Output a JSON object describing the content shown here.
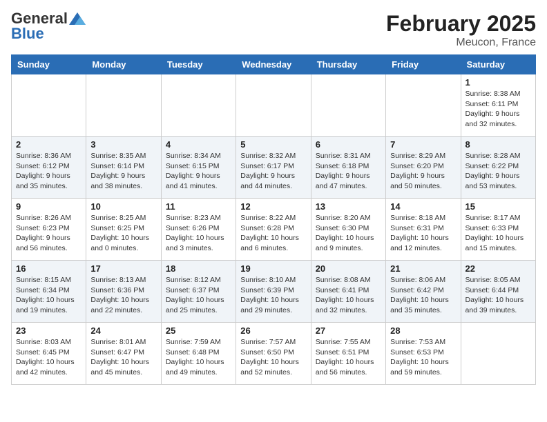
{
  "header": {
    "logo_general": "General",
    "logo_blue": "Blue",
    "month": "February 2025",
    "location": "Meucon, France"
  },
  "weekdays": [
    "Sunday",
    "Monday",
    "Tuesday",
    "Wednesday",
    "Thursday",
    "Friday",
    "Saturday"
  ],
  "weeks": [
    [
      {
        "day": "",
        "info": ""
      },
      {
        "day": "",
        "info": ""
      },
      {
        "day": "",
        "info": ""
      },
      {
        "day": "",
        "info": ""
      },
      {
        "day": "",
        "info": ""
      },
      {
        "day": "",
        "info": ""
      },
      {
        "day": "1",
        "info": "Sunrise: 8:38 AM\nSunset: 6:11 PM\nDaylight: 9 hours and 32 minutes."
      }
    ],
    [
      {
        "day": "2",
        "info": "Sunrise: 8:36 AM\nSunset: 6:12 PM\nDaylight: 9 hours and 35 minutes."
      },
      {
        "day": "3",
        "info": "Sunrise: 8:35 AM\nSunset: 6:14 PM\nDaylight: 9 hours and 38 minutes."
      },
      {
        "day": "4",
        "info": "Sunrise: 8:34 AM\nSunset: 6:15 PM\nDaylight: 9 hours and 41 minutes."
      },
      {
        "day": "5",
        "info": "Sunrise: 8:32 AM\nSunset: 6:17 PM\nDaylight: 9 hours and 44 minutes."
      },
      {
        "day": "6",
        "info": "Sunrise: 8:31 AM\nSunset: 6:18 PM\nDaylight: 9 hours and 47 minutes."
      },
      {
        "day": "7",
        "info": "Sunrise: 8:29 AM\nSunset: 6:20 PM\nDaylight: 9 hours and 50 minutes."
      },
      {
        "day": "8",
        "info": "Sunrise: 8:28 AM\nSunset: 6:22 PM\nDaylight: 9 hours and 53 minutes."
      }
    ],
    [
      {
        "day": "9",
        "info": "Sunrise: 8:26 AM\nSunset: 6:23 PM\nDaylight: 9 hours and 56 minutes."
      },
      {
        "day": "10",
        "info": "Sunrise: 8:25 AM\nSunset: 6:25 PM\nDaylight: 10 hours and 0 minutes."
      },
      {
        "day": "11",
        "info": "Sunrise: 8:23 AM\nSunset: 6:26 PM\nDaylight: 10 hours and 3 minutes."
      },
      {
        "day": "12",
        "info": "Sunrise: 8:22 AM\nSunset: 6:28 PM\nDaylight: 10 hours and 6 minutes."
      },
      {
        "day": "13",
        "info": "Sunrise: 8:20 AM\nSunset: 6:30 PM\nDaylight: 10 hours and 9 minutes."
      },
      {
        "day": "14",
        "info": "Sunrise: 8:18 AM\nSunset: 6:31 PM\nDaylight: 10 hours and 12 minutes."
      },
      {
        "day": "15",
        "info": "Sunrise: 8:17 AM\nSunset: 6:33 PM\nDaylight: 10 hours and 15 minutes."
      }
    ],
    [
      {
        "day": "16",
        "info": "Sunrise: 8:15 AM\nSunset: 6:34 PM\nDaylight: 10 hours and 19 minutes."
      },
      {
        "day": "17",
        "info": "Sunrise: 8:13 AM\nSunset: 6:36 PM\nDaylight: 10 hours and 22 minutes."
      },
      {
        "day": "18",
        "info": "Sunrise: 8:12 AM\nSunset: 6:37 PM\nDaylight: 10 hours and 25 minutes."
      },
      {
        "day": "19",
        "info": "Sunrise: 8:10 AM\nSunset: 6:39 PM\nDaylight: 10 hours and 29 minutes."
      },
      {
        "day": "20",
        "info": "Sunrise: 8:08 AM\nSunset: 6:41 PM\nDaylight: 10 hours and 32 minutes."
      },
      {
        "day": "21",
        "info": "Sunrise: 8:06 AM\nSunset: 6:42 PM\nDaylight: 10 hours and 35 minutes."
      },
      {
        "day": "22",
        "info": "Sunrise: 8:05 AM\nSunset: 6:44 PM\nDaylight: 10 hours and 39 minutes."
      }
    ],
    [
      {
        "day": "23",
        "info": "Sunrise: 8:03 AM\nSunset: 6:45 PM\nDaylight: 10 hours and 42 minutes."
      },
      {
        "day": "24",
        "info": "Sunrise: 8:01 AM\nSunset: 6:47 PM\nDaylight: 10 hours and 45 minutes."
      },
      {
        "day": "25",
        "info": "Sunrise: 7:59 AM\nSunset: 6:48 PM\nDaylight: 10 hours and 49 minutes."
      },
      {
        "day": "26",
        "info": "Sunrise: 7:57 AM\nSunset: 6:50 PM\nDaylight: 10 hours and 52 minutes."
      },
      {
        "day": "27",
        "info": "Sunrise: 7:55 AM\nSunset: 6:51 PM\nDaylight: 10 hours and 56 minutes."
      },
      {
        "day": "28",
        "info": "Sunrise: 7:53 AM\nSunset: 6:53 PM\nDaylight: 10 hours and 59 minutes."
      },
      {
        "day": "",
        "info": ""
      }
    ]
  ]
}
